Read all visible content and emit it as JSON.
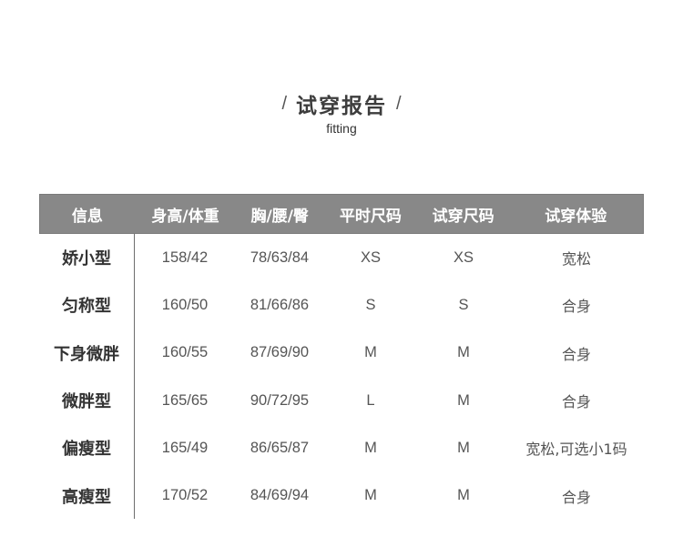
{
  "header": {
    "left_slash": "/",
    "title": "试穿报告",
    "right_slash": "/",
    "subtitle": "fitting"
  },
  "table": {
    "columns": [
      "信息",
      "身高/体重",
      "胸/腰/臀",
      "平时尺码",
      "试穿尺码",
      "试穿体验"
    ],
    "rows": [
      [
        "娇小型",
        "158/42",
        "78/63/84",
        "XS",
        "XS",
        "宽松"
      ],
      [
        "匀称型",
        "160/50",
        "81/66/86",
        "S",
        "S",
        "合身"
      ],
      [
        "下身微胖",
        "160/55",
        "87/69/90",
        "M",
        "M",
        "合身"
      ],
      [
        "微胖型",
        "165/65",
        "90/72/95",
        "L",
        "M",
        "合身"
      ],
      [
        "偏瘦型",
        "165/49",
        "86/65/87",
        "M",
        "M",
        "宽松,可选小1码"
      ],
      [
        "高瘦型",
        "170/52",
        "84/69/94",
        "M",
        "M",
        "合身"
      ]
    ]
  },
  "colors": {
    "header_bg": "#888888",
    "header_text": "#ffffff",
    "body_text": "#555555"
  }
}
